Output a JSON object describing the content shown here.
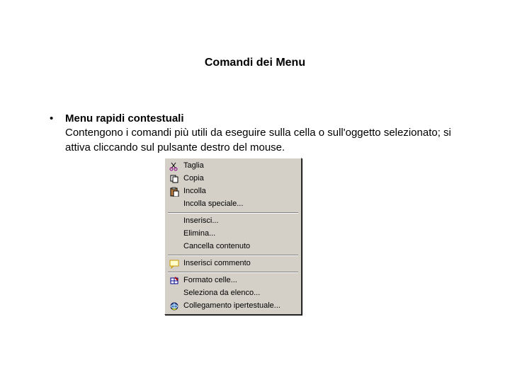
{
  "title": "Comandi dei Menu",
  "bullet": {
    "marker": "•",
    "heading": "Menu rapidi contestuali",
    "text": "Contengono i comandi più utili da eseguire sulla cella o sull'oggetto selezionato; si attiva cliccando sul pulsante destro del mouse."
  },
  "context_menu": {
    "items": [
      {
        "label": "Taglia",
        "icon": "cut-icon"
      },
      {
        "label": "Copia",
        "icon": "copy-icon"
      },
      {
        "label": "Incolla",
        "icon": "paste-icon"
      },
      {
        "label": "Incolla speciale...",
        "icon": ""
      },
      {
        "sep": true
      },
      {
        "label": "Inserisci...",
        "icon": ""
      },
      {
        "label": "Elimina...",
        "icon": ""
      },
      {
        "label": "Cancella contenuto",
        "icon": ""
      },
      {
        "sep": true
      },
      {
        "label": "Inserisci commento",
        "icon": "comment-icon"
      },
      {
        "sep": true
      },
      {
        "label": "Formato celle...",
        "icon": "format-cells-icon"
      },
      {
        "label": "Seleziona da elenco...",
        "icon": ""
      },
      {
        "label": "Collegamento ipertestuale...",
        "icon": "hyperlink-icon"
      }
    ]
  }
}
